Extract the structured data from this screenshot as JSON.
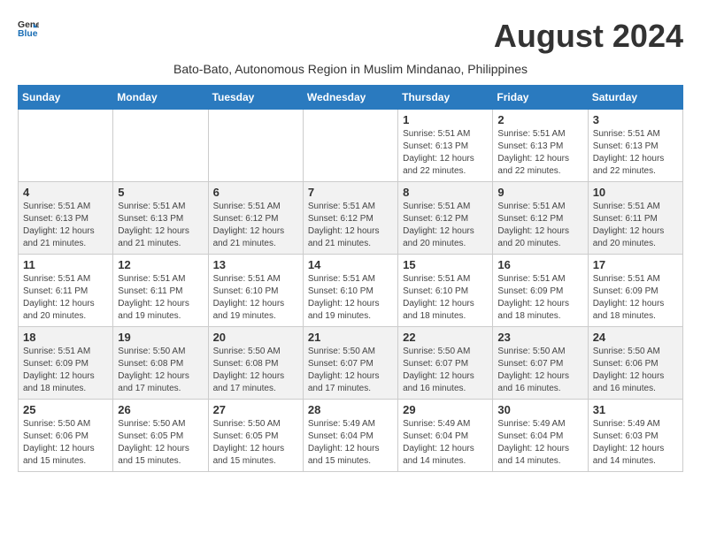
{
  "header": {
    "logo_line1": "General",
    "logo_line2": "Blue",
    "month_title": "August 2024",
    "subtitle": "Bato-Bato, Autonomous Region in Muslim Mindanao, Philippines"
  },
  "days_of_week": [
    "Sunday",
    "Monday",
    "Tuesday",
    "Wednesday",
    "Thursday",
    "Friday",
    "Saturday"
  ],
  "weeks": [
    [
      {
        "day": "",
        "info": ""
      },
      {
        "day": "",
        "info": ""
      },
      {
        "day": "",
        "info": ""
      },
      {
        "day": "",
        "info": ""
      },
      {
        "day": "1",
        "info": "Sunrise: 5:51 AM\nSunset: 6:13 PM\nDaylight: 12 hours and 22 minutes."
      },
      {
        "day": "2",
        "info": "Sunrise: 5:51 AM\nSunset: 6:13 PM\nDaylight: 12 hours and 22 minutes."
      },
      {
        "day": "3",
        "info": "Sunrise: 5:51 AM\nSunset: 6:13 PM\nDaylight: 12 hours and 22 minutes."
      }
    ],
    [
      {
        "day": "4",
        "info": "Sunrise: 5:51 AM\nSunset: 6:13 PM\nDaylight: 12 hours and 21 minutes."
      },
      {
        "day": "5",
        "info": "Sunrise: 5:51 AM\nSunset: 6:13 PM\nDaylight: 12 hours and 21 minutes."
      },
      {
        "day": "6",
        "info": "Sunrise: 5:51 AM\nSunset: 6:12 PM\nDaylight: 12 hours and 21 minutes."
      },
      {
        "day": "7",
        "info": "Sunrise: 5:51 AM\nSunset: 6:12 PM\nDaylight: 12 hours and 21 minutes."
      },
      {
        "day": "8",
        "info": "Sunrise: 5:51 AM\nSunset: 6:12 PM\nDaylight: 12 hours and 20 minutes."
      },
      {
        "day": "9",
        "info": "Sunrise: 5:51 AM\nSunset: 6:12 PM\nDaylight: 12 hours and 20 minutes."
      },
      {
        "day": "10",
        "info": "Sunrise: 5:51 AM\nSunset: 6:11 PM\nDaylight: 12 hours and 20 minutes."
      }
    ],
    [
      {
        "day": "11",
        "info": "Sunrise: 5:51 AM\nSunset: 6:11 PM\nDaylight: 12 hours and 20 minutes."
      },
      {
        "day": "12",
        "info": "Sunrise: 5:51 AM\nSunset: 6:11 PM\nDaylight: 12 hours and 19 minutes."
      },
      {
        "day": "13",
        "info": "Sunrise: 5:51 AM\nSunset: 6:10 PM\nDaylight: 12 hours and 19 minutes."
      },
      {
        "day": "14",
        "info": "Sunrise: 5:51 AM\nSunset: 6:10 PM\nDaylight: 12 hours and 19 minutes."
      },
      {
        "day": "15",
        "info": "Sunrise: 5:51 AM\nSunset: 6:10 PM\nDaylight: 12 hours and 18 minutes."
      },
      {
        "day": "16",
        "info": "Sunrise: 5:51 AM\nSunset: 6:09 PM\nDaylight: 12 hours and 18 minutes."
      },
      {
        "day": "17",
        "info": "Sunrise: 5:51 AM\nSunset: 6:09 PM\nDaylight: 12 hours and 18 minutes."
      }
    ],
    [
      {
        "day": "18",
        "info": "Sunrise: 5:51 AM\nSunset: 6:09 PM\nDaylight: 12 hours and 18 minutes."
      },
      {
        "day": "19",
        "info": "Sunrise: 5:50 AM\nSunset: 6:08 PM\nDaylight: 12 hours and 17 minutes."
      },
      {
        "day": "20",
        "info": "Sunrise: 5:50 AM\nSunset: 6:08 PM\nDaylight: 12 hours and 17 minutes."
      },
      {
        "day": "21",
        "info": "Sunrise: 5:50 AM\nSunset: 6:07 PM\nDaylight: 12 hours and 17 minutes."
      },
      {
        "day": "22",
        "info": "Sunrise: 5:50 AM\nSunset: 6:07 PM\nDaylight: 12 hours and 16 minutes."
      },
      {
        "day": "23",
        "info": "Sunrise: 5:50 AM\nSunset: 6:07 PM\nDaylight: 12 hours and 16 minutes."
      },
      {
        "day": "24",
        "info": "Sunrise: 5:50 AM\nSunset: 6:06 PM\nDaylight: 12 hours and 16 minutes."
      }
    ],
    [
      {
        "day": "25",
        "info": "Sunrise: 5:50 AM\nSunset: 6:06 PM\nDaylight: 12 hours and 15 minutes."
      },
      {
        "day": "26",
        "info": "Sunrise: 5:50 AM\nSunset: 6:05 PM\nDaylight: 12 hours and 15 minutes."
      },
      {
        "day": "27",
        "info": "Sunrise: 5:50 AM\nSunset: 6:05 PM\nDaylight: 12 hours and 15 minutes."
      },
      {
        "day": "28",
        "info": "Sunrise: 5:49 AM\nSunset: 6:04 PM\nDaylight: 12 hours and 15 minutes."
      },
      {
        "day": "29",
        "info": "Sunrise: 5:49 AM\nSunset: 6:04 PM\nDaylight: 12 hours and 14 minutes."
      },
      {
        "day": "30",
        "info": "Sunrise: 5:49 AM\nSunset: 6:04 PM\nDaylight: 12 hours and 14 minutes."
      },
      {
        "day": "31",
        "info": "Sunrise: 5:49 AM\nSunset: 6:03 PM\nDaylight: 12 hours and 14 minutes."
      }
    ]
  ]
}
